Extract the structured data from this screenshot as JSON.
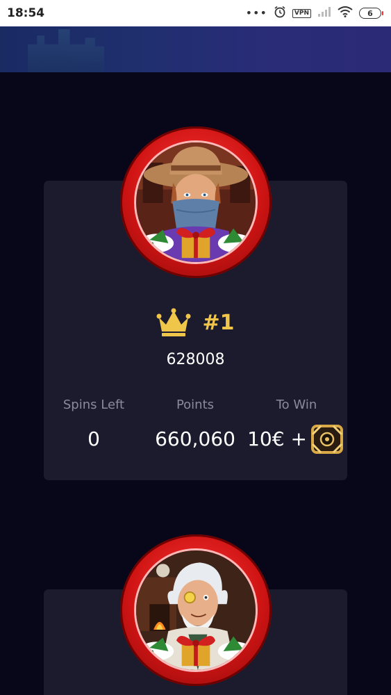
{
  "status_bar": {
    "time": "18:54",
    "vpn_label": "VPN",
    "battery_level": "6",
    "icons": [
      "more-dots-icon",
      "alarm-icon",
      "vpn-badge",
      "signal-icon",
      "wifi-icon",
      "battery-icon"
    ]
  },
  "banner": {
    "icon": "castle-banner-image"
  },
  "leaderboard": [
    {
      "rank": "#1",
      "player_id": "628008",
      "avatar": "cowboy-bandit-avatar",
      "stats": {
        "spins_left_label": "Spins Left",
        "spins_left": "0",
        "points_label": "Points",
        "points": "660,060",
        "to_win_label": "To Win",
        "to_win": "10€ +",
        "prize_icon": "mystery-box-icon"
      }
    },
    {
      "avatar": "wizard-scientist-avatar"
    }
  ],
  "colors": {
    "background": "#08071a",
    "card": "#1c1b2d",
    "rank_gold": "#f0c64a",
    "avatar_ring": "#d01414",
    "label_gray": "#8a8a9e"
  }
}
